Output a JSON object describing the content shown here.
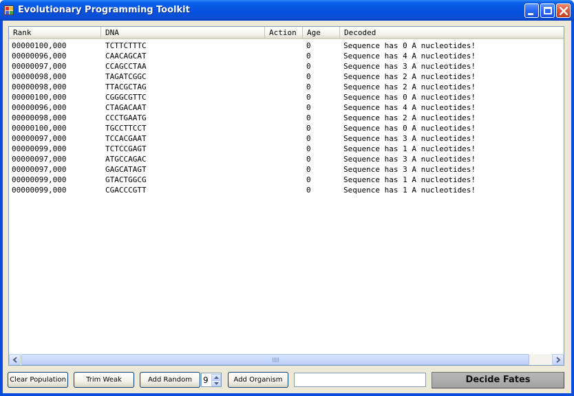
{
  "window": {
    "title": "Evolutionary Programming Toolkit",
    "icon": "app-icon"
  },
  "listview": {
    "columns": [
      "Rank",
      "DNA",
      "Action",
      "Age",
      "Decoded"
    ],
    "rows": [
      {
        "rank": "00000100,000",
        "dna": "TCTTCTTTC",
        "action": "",
        "age": "0",
        "decoded": "Sequence has 0 A nucleotides!"
      },
      {
        "rank": "00000096,000",
        "dna": "CAACAGCAT",
        "action": "",
        "age": "0",
        "decoded": "Sequence has 4 A nucleotides!"
      },
      {
        "rank": "00000097,000",
        "dna": "CCAGCCTAA",
        "action": "",
        "age": "0",
        "decoded": "Sequence has 3 A nucleotides!"
      },
      {
        "rank": "00000098,000",
        "dna": "TAGATCGGC",
        "action": "",
        "age": "0",
        "decoded": "Sequence has 2 A nucleotides!"
      },
      {
        "rank": "00000098,000",
        "dna": "TTACGCTAG",
        "action": "",
        "age": "0",
        "decoded": "Sequence has 2 A nucleotides!"
      },
      {
        "rank": "00000100,000",
        "dna": "CGGGCGTTC",
        "action": "",
        "age": "0",
        "decoded": "Sequence has 0 A nucleotides!"
      },
      {
        "rank": "00000096,000",
        "dna": "CTAGACAAT",
        "action": "",
        "age": "0",
        "decoded": "Sequence has 4 A nucleotides!"
      },
      {
        "rank": "00000098,000",
        "dna": "CCCTGAATG",
        "action": "",
        "age": "0",
        "decoded": "Sequence has 2 A nucleotides!"
      },
      {
        "rank": "00000100,000",
        "dna": "TGCCTTCCT",
        "action": "",
        "age": "0",
        "decoded": "Sequence has 0 A nucleotides!"
      },
      {
        "rank": "00000097,000",
        "dna": "TCCACGAAT",
        "action": "",
        "age": "0",
        "decoded": "Sequence has 3 A nucleotides!"
      },
      {
        "rank": "00000099,000",
        "dna": "TCTCCGAGT",
        "action": "",
        "age": "0",
        "decoded": "Sequence has 1 A nucleotides!"
      },
      {
        "rank": "00000097,000",
        "dna": "ATGCCAGAC",
        "action": "",
        "age": "0",
        "decoded": "Sequence has 3 A nucleotides!"
      },
      {
        "rank": "00000097,000",
        "dna": "GAGCATAGT",
        "action": "",
        "age": "0",
        "decoded": "Sequence has 3 A nucleotides!"
      },
      {
        "rank": "00000099,000",
        "dna": "GTACTGGCG",
        "action": "",
        "age": "0",
        "decoded": "Sequence has 1 A nucleotides!"
      },
      {
        "rank": "00000099,000",
        "dna": "CGACCCGTT",
        "action": "",
        "age": "0",
        "decoded": "Sequence has 1 A nucleotides!"
      }
    ]
  },
  "toolbar": {
    "clear_label": "Clear Population",
    "trim_label": "Trim Weak",
    "add_random_label": "Add Random",
    "random_count": "9",
    "add_organism_label": "Add Organism",
    "organism_input_value": "",
    "decide_label": "Decide Fates"
  },
  "colors": {
    "titlebar": "#0453df",
    "client": "#ece9d8",
    "decide_button": "#a9a9a9",
    "close_button": "#dc5638"
  }
}
